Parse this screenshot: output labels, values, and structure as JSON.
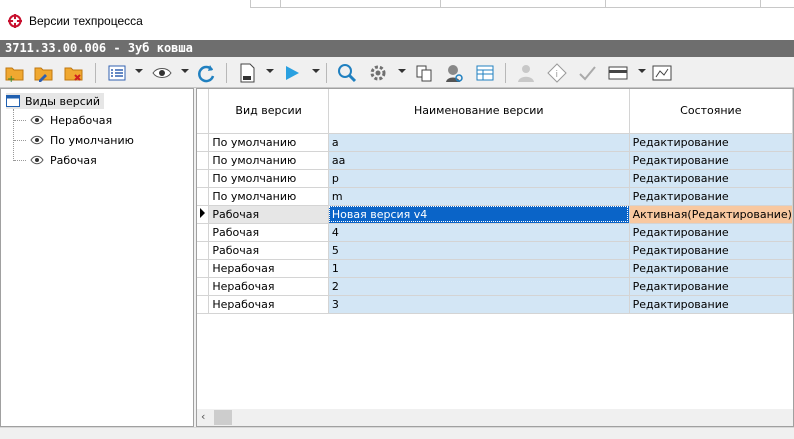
{
  "window": {
    "title": "Версии техпроцесса"
  },
  "document": {
    "header": "3711.33.00.006 - Зуб ковша"
  },
  "toolbar": {
    "icons": [
      "folder-add-icon",
      "folder-edit-icon",
      "folder-delete-icon",
      "list-view-icon",
      "eye-icon",
      "refresh-icon",
      "document-icon",
      "play-icon",
      "search-icon",
      "settings-icon",
      "copy-icon",
      "user-search-icon",
      "table-icon",
      "person-icon",
      "info-icon",
      "approve-icon",
      "card-icon",
      "shuffle-icon"
    ]
  },
  "tree": {
    "root": "Виды версий",
    "items": [
      "Нерабочая",
      "По умолчанию",
      "Рабочая"
    ]
  },
  "grid": {
    "columns": [
      "Вид версии",
      "Наименование версии",
      "Состояние"
    ],
    "rows": [
      {
        "kind": "По умолчанию",
        "name": "a",
        "state": "Редактирование"
      },
      {
        "kind": "По умолчанию",
        "name": "aa",
        "state": "Редактирование"
      },
      {
        "kind": "По умолчанию",
        "name": "p",
        "state": "Редактирование"
      },
      {
        "kind": "По умолчанию",
        "name": "m",
        "state": "Редактирование"
      },
      {
        "kind": "Рабочая",
        "name": "Новая версия v4",
        "state": "Активная(Редактирование)",
        "selected": true
      },
      {
        "kind": "Рабочая",
        "name": "4",
        "state": "Редактирование"
      },
      {
        "kind": "Рабочая",
        "name": "5",
        "state": "Редактирование"
      },
      {
        "kind": "Нерабочая",
        "name": "1",
        "state": "Редактирование"
      },
      {
        "kind": "Нерабочая",
        "name": "2",
        "state": "Редактирование"
      },
      {
        "kind": "Нерабочая",
        "name": "3",
        "state": "Редактирование"
      }
    ]
  },
  "colors": {
    "accent": "#0a64c8",
    "row_bg": "#d3e6f5",
    "active_state": "#f8c8a0",
    "doc_bar": "#6e6e6e"
  }
}
